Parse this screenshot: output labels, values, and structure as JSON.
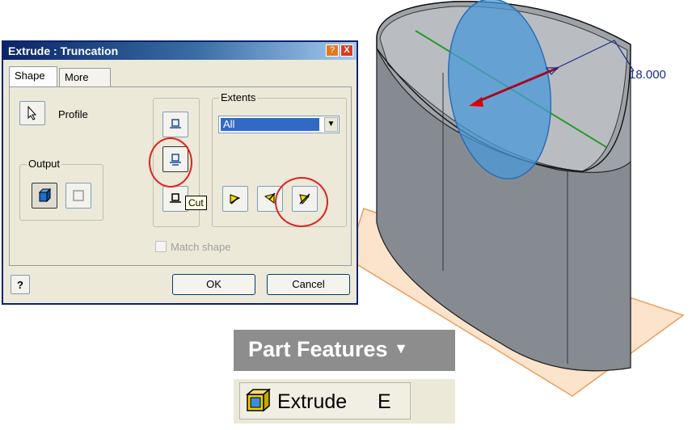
{
  "dialog": {
    "title": "Extrude : Truncation",
    "help_btn": "?",
    "close_btn": "X",
    "tabs": [
      {
        "label": "Shape"
      },
      {
        "label": "More"
      }
    ],
    "profile_label": "Profile",
    "output_label": "Output",
    "extents_label": "Extents",
    "extents_value": "All",
    "tooltip": "Cut",
    "match_shape_label": "Match shape",
    "ok_label": "OK",
    "cancel_label": "Cancel",
    "help_bottom": "?"
  },
  "model": {
    "dimension": "18.000"
  },
  "palette": {
    "title": "Part Features",
    "arrow": "▼",
    "item_label": "Extrude",
    "item_shortcut": "E"
  },
  "colors": {
    "highlight_circle": "#e02020",
    "title_gradient": "#0a246a",
    "plane": "#3a8fd8",
    "dimension": "#1a2b8c"
  }
}
